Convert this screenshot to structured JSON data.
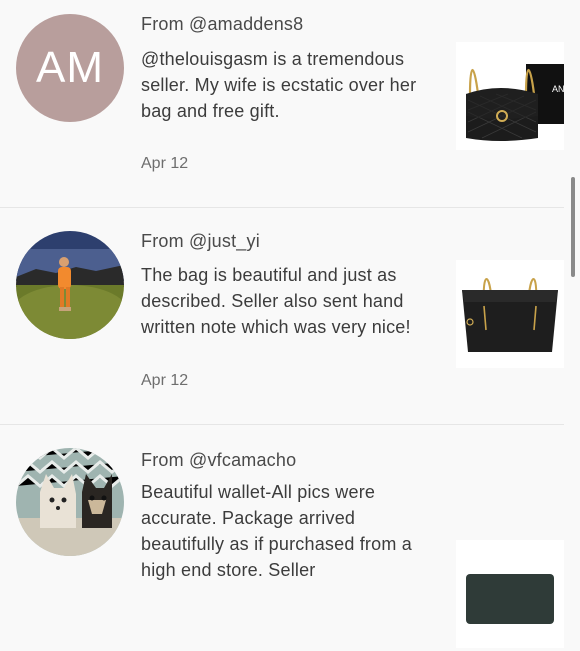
{
  "reviews": [
    {
      "avatar_initials": "AM",
      "from": "From @amaddens8",
      "comment": "@thelouisgasm is a tremendous seller. My wife is ecstatic over her bag and free gift.",
      "date": "Apr 12",
      "product_icon": "quilted-flap-bag-icon",
      "box_text": "AN"
    },
    {
      "from": "From @just_yi",
      "comment": "The bag is beautiful and just as described. Seller also sent hand written note which was very nice!",
      "date": "Apr 12",
      "product_icon": "tote-bag-icon"
    },
    {
      "from": "From @vfcamacho",
      "comment": "Beautiful wallet-All pics were accurate. Package arrived beautifully as if purchased from a high end store. Seller",
      "date": "",
      "product_icon": "wallet-icon"
    }
  ],
  "colors": {
    "background": "#f9f9f9",
    "avatar_initials_bg": "#b89e9c",
    "text": "#3c3c3c",
    "muted": "#6e6e6e"
  }
}
